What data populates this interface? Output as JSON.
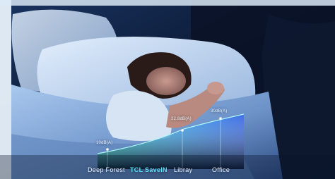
{
  "image": {
    "subject": "woman-sleeping-in-bed",
    "colors": {
      "background": "#0a1428",
      "sheets": "#8fb4e0",
      "pillow": "#c9dcf5",
      "skin": "#b88a80",
      "hair": "#2a1a18",
      "accent": "#41d8ff",
      "gradient_start": "#0ef0d0",
      "gradient_end": "#2a5cf0"
    }
  },
  "noise_levels": [
    {
      "value": "10dB(A)"
    },
    {
      "value": "22.8dB(A)"
    },
    {
      "value": "30dB(A)"
    }
  ],
  "environments": [
    {
      "label": "Deep Forest",
      "highlight": false
    },
    {
      "label": "TCL SaveIN",
      "highlight": true
    },
    {
      "label": "Libray",
      "highlight": false
    },
    {
      "label": "Office",
      "highlight": false
    }
  ]
}
